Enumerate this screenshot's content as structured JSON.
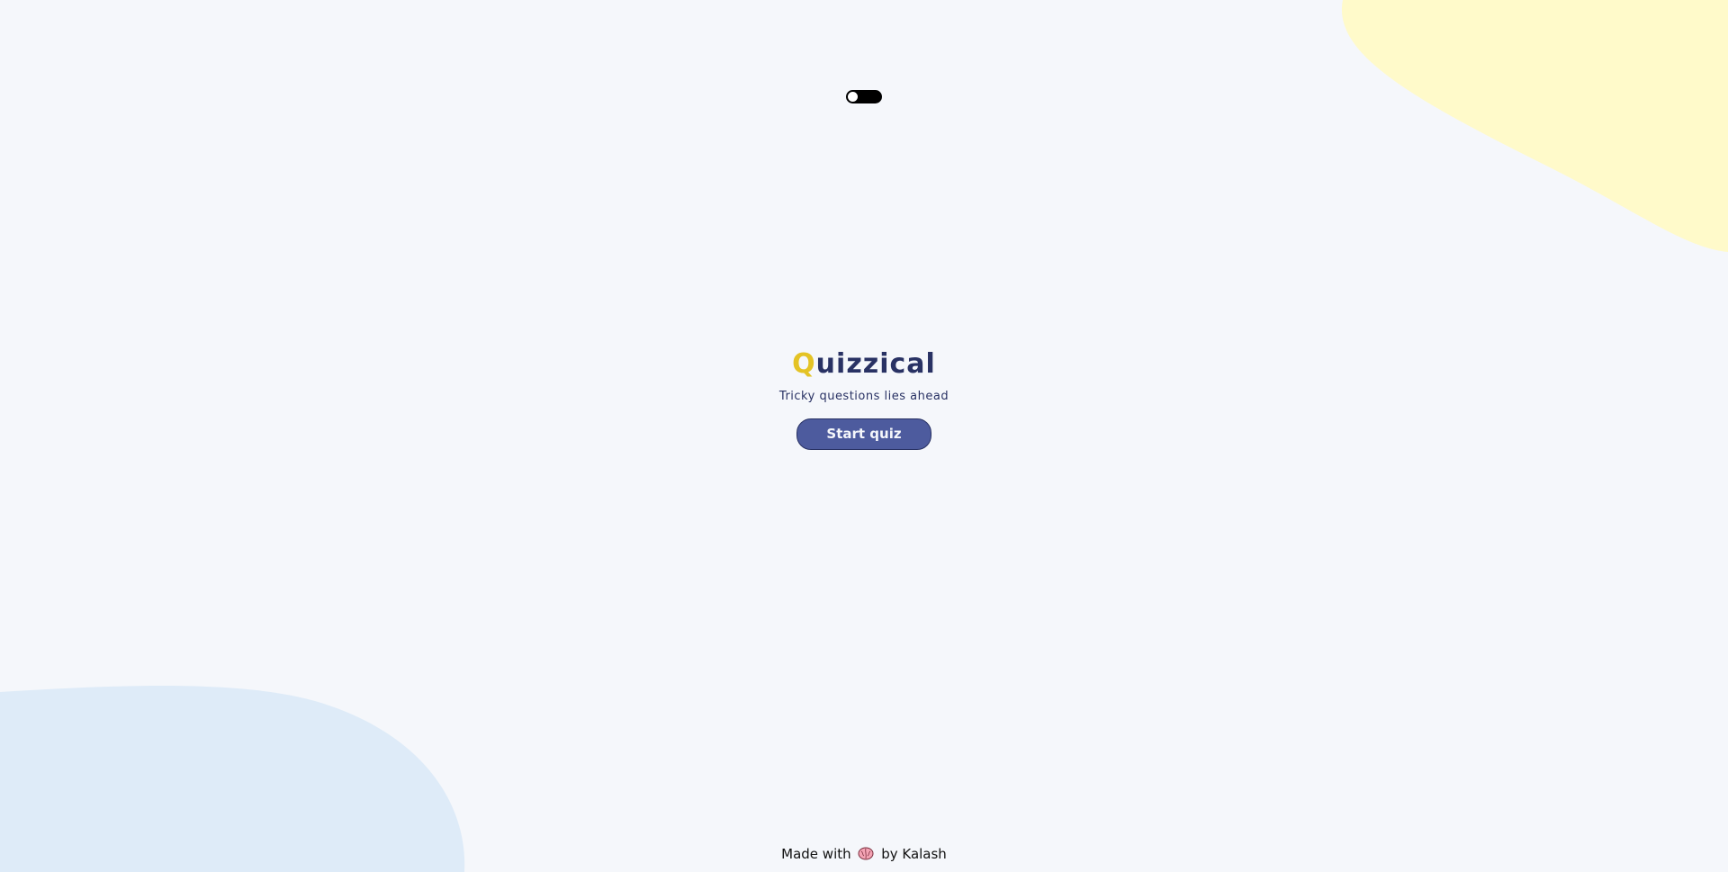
{
  "theme_toggle": {
    "state": "off"
  },
  "hero": {
    "title_first_letter": "Q",
    "title_rest": "uizzical",
    "subtitle": "Tricky questions lies ahead",
    "start_button_label": "Start quiz"
  },
  "footer": {
    "prefix": "Made with",
    "icon": "brain-icon",
    "suffix": "by Kalash"
  },
  "colors": {
    "background": "#f5f7fb",
    "blob_yellow": "#fffaca",
    "blob_blue": "#deebf8",
    "title": "#293264",
    "title_accent": "#e4c325",
    "button": "#4d5b9e"
  }
}
